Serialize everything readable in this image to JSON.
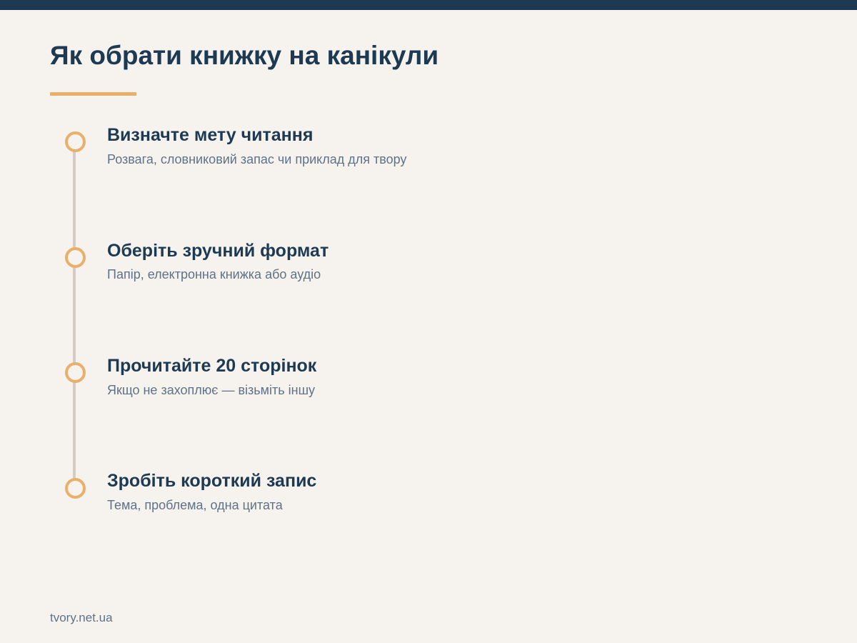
{
  "page": {
    "title": "Як обрати книжку на канікули"
  },
  "steps": [
    {
      "title": "Визначте мету читання",
      "description": "Розвага, словниковий запас чи приклад для твору"
    },
    {
      "title": "Оберіть зручний формат",
      "description": "Папір, електронна книжка або аудіо"
    },
    {
      "title": "Прочитайте 20 сторінок",
      "description": "Якщо не захоплює — візьміть іншу"
    },
    {
      "title": "Зробіть короткий запис",
      "description": "Тема, проблема, одна цитата"
    }
  ],
  "footer": {
    "site": "tvory.net.ua"
  },
  "colors": {
    "background": "#f6f3ee",
    "primary": "#1e3a52",
    "accent": "#e8b06b",
    "timeline": "#d5cdc1",
    "muted_text": "#5f7287"
  }
}
